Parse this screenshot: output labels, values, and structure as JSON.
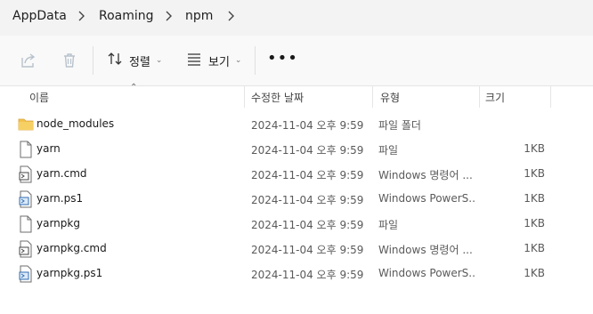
{
  "breadcrumb": [
    "AppData",
    "Roaming",
    "npm"
  ],
  "toolbar": {
    "share_icon": "share-icon",
    "delete_icon": "trash-icon",
    "sort_label": "정렬",
    "view_label": "보기",
    "more_label": "•••"
  },
  "columns": {
    "name": "이름",
    "date": "수정한 날짜",
    "type": "유형",
    "size": "크기"
  },
  "files": [
    {
      "name": "node_modules",
      "date": "2024-11-04 오후 9:59",
      "type": "파일 폴더",
      "size": "",
      "icon": "folder-icon"
    },
    {
      "name": "yarn",
      "date": "2024-11-04 오후 9:59",
      "type": "파일",
      "size": "1KB",
      "icon": "file-icon"
    },
    {
      "name": "yarn.cmd",
      "date": "2024-11-04 오후 9:59",
      "type": "Windows 명령어 ...",
      "size": "1KB",
      "icon": "cmd-file-icon"
    },
    {
      "name": "yarn.ps1",
      "date": "2024-11-04 오후 9:59",
      "type": "Windows PowerS...",
      "size": "1KB",
      "icon": "powershell-file-icon"
    },
    {
      "name": "yarnpkg",
      "date": "2024-11-04 오후 9:59",
      "type": "파일",
      "size": "1KB",
      "icon": "file-icon"
    },
    {
      "name": "yarnpkg.cmd",
      "date": "2024-11-04 오후 9:59",
      "type": "Windows 명령어 ...",
      "size": "1KB",
      "icon": "cmd-file-icon"
    },
    {
      "name": "yarnpkg.ps1",
      "date": "2024-11-04 오후 9:59",
      "type": "Windows PowerS...",
      "size": "1KB",
      "icon": "powershell-file-icon"
    }
  ],
  "colors": {
    "folder": "#f2c24d",
    "toolbar_bg": "#f9f9f9",
    "address_bg": "#f3f3f3"
  }
}
